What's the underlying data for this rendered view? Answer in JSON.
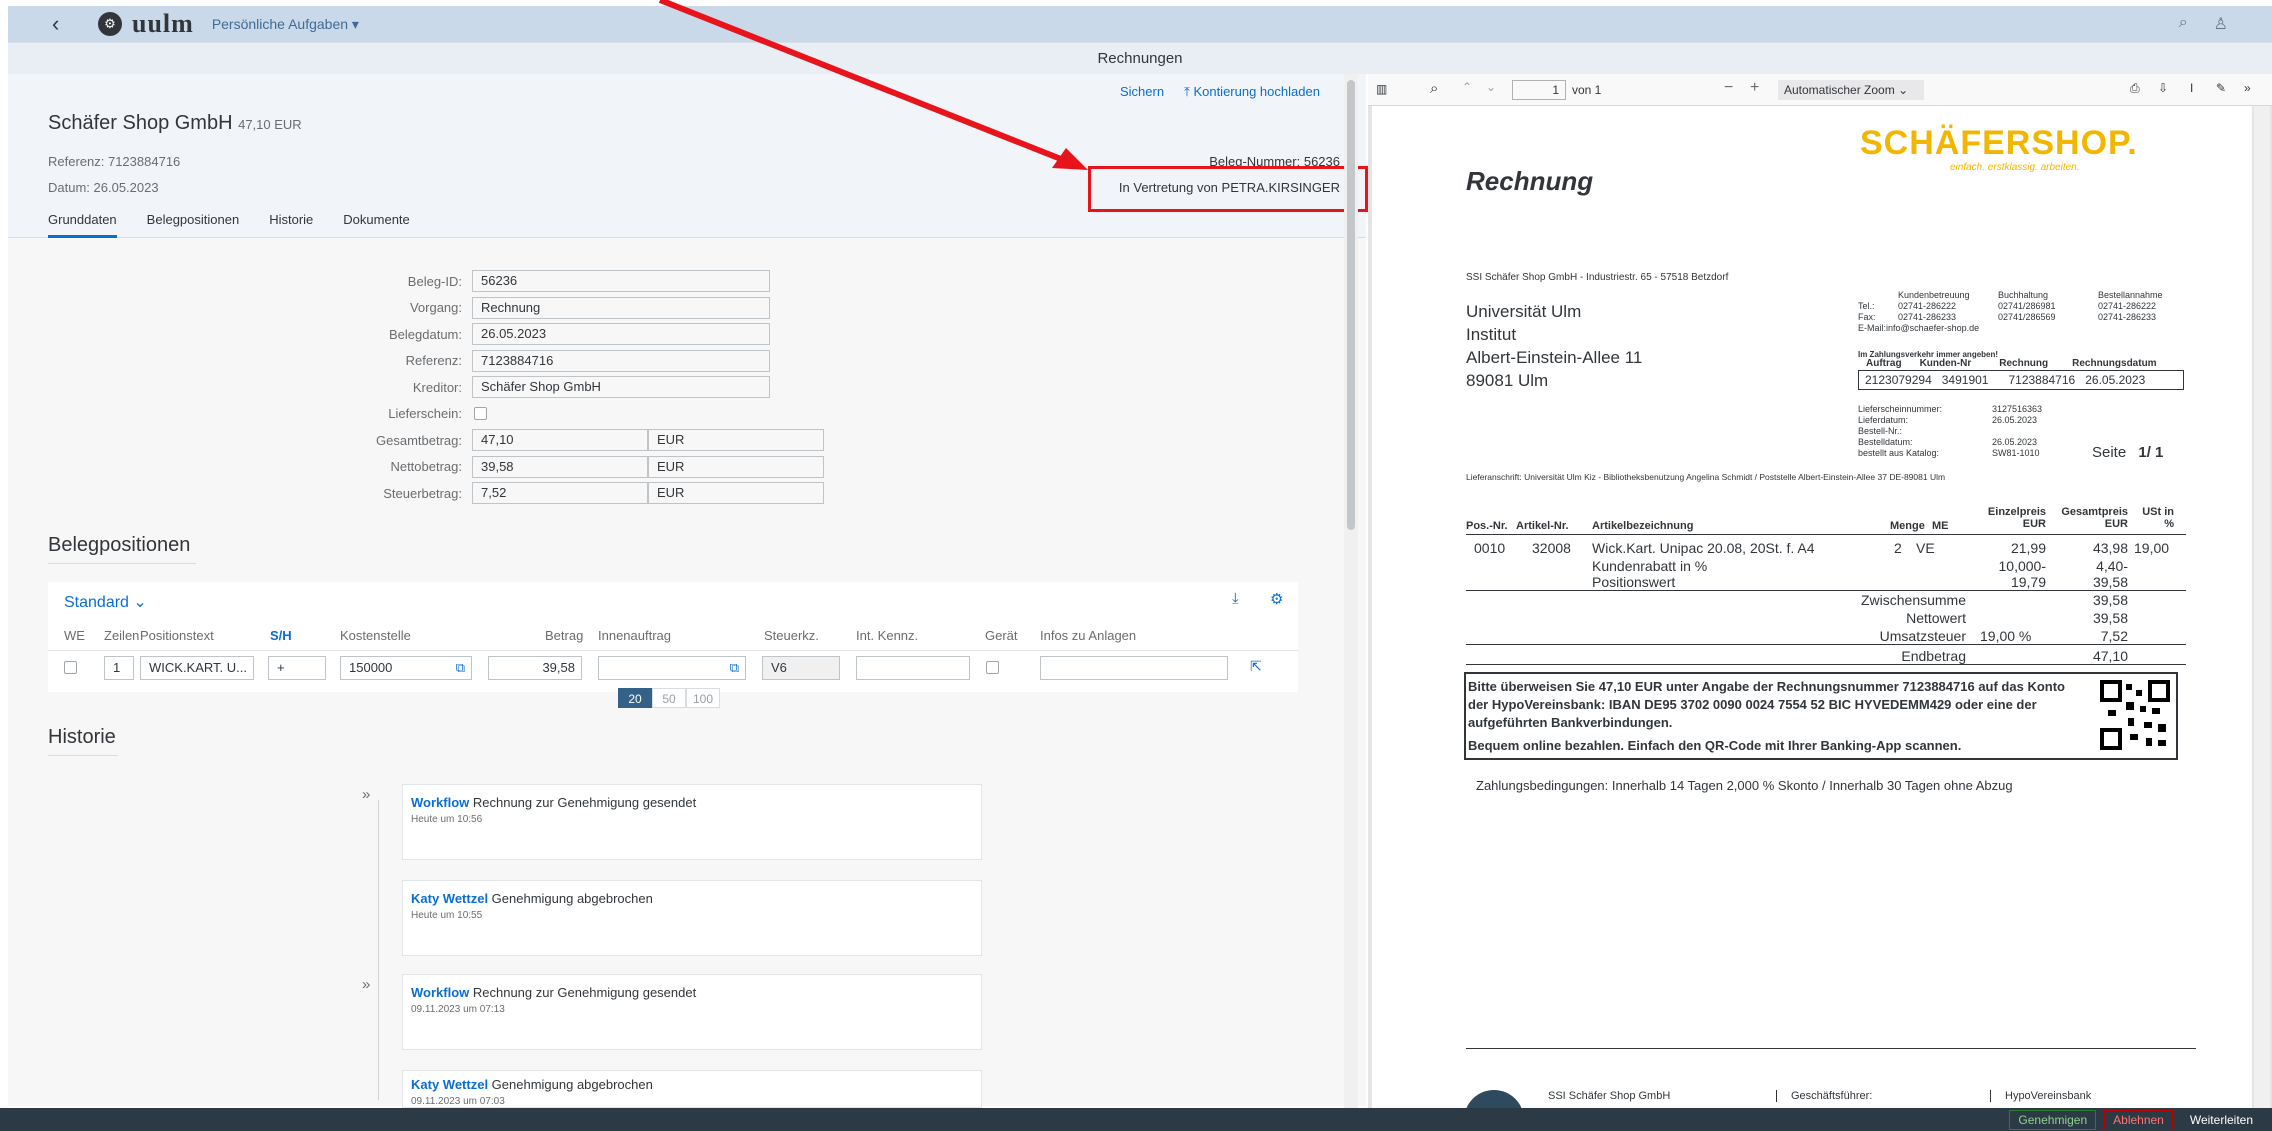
{
  "shell": {
    "app_title": "Persönliche Aufgaben ▾",
    "logo_text": "uulm",
    "logo_symbol": "⚙"
  },
  "page_header": "Rechnungen",
  "header": {
    "vendor": "Schäfer Shop GmbH",
    "amount": "47,10 EUR",
    "referenz": "Referenz: 7123884716",
    "datum": "Datum: 26.05.2023",
    "beleg_nummer": "Beleg-Nummer: 56236",
    "vertretung": "In Vertretung von PETRA.KIRSINGER",
    "actions": {
      "save": "Sichern",
      "upload": "Kontierung hochladen"
    }
  },
  "tabs": [
    "Grunddaten",
    "Belegpositionen",
    "Historie",
    "Dokumente"
  ],
  "grunddaten": {
    "beleg_id": {
      "label": "Beleg-ID:",
      "value": "56236"
    },
    "vorgang": {
      "label": "Vorgang:",
      "value": "Rechnung"
    },
    "belegdatum": {
      "label": "Belegdatum:",
      "value": "26.05.2023"
    },
    "referenz": {
      "label": "Referenz:",
      "value": "7123884716"
    },
    "kreditor": {
      "label": "Kreditor:",
      "value": "Schäfer Shop GmbH"
    },
    "lieferschein": {
      "label": "Lieferschein:"
    },
    "gesamtbetrag": {
      "label": "Gesamtbetrag:",
      "value": "47,10",
      "currency": "EUR"
    },
    "nettobetrag": {
      "label": "Nettobetrag:",
      "value": "39,58",
      "currency": "EUR"
    },
    "steuerbetrag": {
      "label": "Steuerbetrag:",
      "value": "7,52",
      "currency": "EUR"
    }
  },
  "belegpositionen": {
    "title": "Belegpositionen",
    "variant": "Standard",
    "columns": [
      "WE",
      "Zeilen",
      "Positionstext",
      "S/H",
      "Kostenstelle",
      "Betrag",
      "Innenauftrag",
      "Steuerkz.",
      "Int. Kennz.",
      "Gerät",
      "Infos zu Anlagen"
    ],
    "row": {
      "zeile": "1",
      "text": "WICK.KART. U...",
      "sh": "+",
      "kostenstelle": "150000",
      "betrag": "39,58",
      "steuerkz": "V6"
    },
    "pager": [
      "20",
      "50",
      "100"
    ]
  },
  "historie": {
    "title": "Historie",
    "entries": [
      {
        "who": "Workflow",
        "text": " Rechnung zur Genehmigung gesendet",
        "time": "Heute um 10:56"
      },
      {
        "who": "Katy Wettzel",
        "text": " Genehmigung abgebrochen",
        "time": "Heute um 10:55"
      },
      {
        "who": "Workflow",
        "text": " Rechnung zur Genehmigung gesendet",
        "time": "09.11.2023 um 07:13"
      },
      {
        "who": "Katy Wettzel",
        "text": " Genehmigung abgebrochen",
        "time": "09.11.2023 um 07:03"
      }
    ]
  },
  "pdf_toolbar": {
    "page": "1",
    "of": "von 1",
    "zoom": "Automatischer Zoom"
  },
  "invoice": {
    "brand": "SCHÄFERSHOP.",
    "brand_tag": "einfach. erstklassig. arbeiten.",
    "title": "Rechnung",
    "sender": "SSI Schäfer Shop GmbH  -  Industriestr. 65  -  57518 Betzdorf",
    "recipient": [
      "Universität Ulm",
      "Institut",
      "Albert-Einstein-Allee 11",
      "89081 Ulm"
    ],
    "contact_head": [
      "Kundenbetreuung",
      "Buchhaltung",
      "Bestellannahme"
    ],
    "tel": [
      "Tel.:",
      "02741-286222",
      "02741/286981",
      "02741-286222"
    ],
    "fax": [
      "Fax:",
      "02741-286233",
      "02741/286569",
      "02741-286233"
    ],
    "email": "E-Mail:info@schaefer-shop.de",
    "ref_note": "Im Zahlungsverkehr immer angeben!",
    "ref_head": [
      "Auftrag",
      "Kunden-Nr",
      "Rechnung",
      "Rechnungsdatum"
    ],
    "ref_vals": [
      "2123079294",
      "3491901",
      "7123884716",
      "26.05.2023"
    ],
    "meta_labels": [
      "Lieferscheinnummer:",
      "Lieferdatum:",
      "Bestell-Nr.:",
      "Bestelldatum:",
      "bestellt aus Katalog:"
    ],
    "meta_vals": [
      "3127516363",
      "26.05.2023",
      "",
      "26.05.2023",
      "SW81-1010"
    ],
    "seite": "Seite",
    "seite_val": "1/ 1",
    "lieferanschrift": "Lieferanschrift: Universität Ulm Kiz - Bibliotheksbenutzung Angelina Schmidt / Poststelle Albert-Einstein-Allee 37 DE-89081 Ulm",
    "cols": [
      "Pos.-Nr.",
      "Artikel-Nr.",
      "Artikelbezeichnung",
      "Menge",
      "ME",
      "Einzelpreis EUR",
      "Gesamtpreis EUR",
      "USt in %"
    ],
    "item": {
      "pos": "0010",
      "art": "32008",
      "desc": "Wick.Kart. Unipac 20.08, 20St. f. A4",
      "menge": "2",
      "me": "VE",
      "ep": "21,99",
      "gp": "43,98",
      "ust": "19,00"
    },
    "rabatt": {
      "label": "Kundenrabatt in %",
      "ep": "10,000-",
      "gp": "4,40-"
    },
    "positionswert": {
      "label": "Positionswert",
      "ep": "19,79",
      "gp": "39,58"
    },
    "zwischensumme": {
      "label": "Zwischensumme",
      "val": "39,58"
    },
    "nettowert": {
      "label": "Nettowert",
      "val": "39,58"
    },
    "umsatzsteuer": {
      "label": "Umsatzsteuer",
      "pct": "19,00 %",
      "val": "7,52"
    },
    "endbetrag": {
      "label": "Endbetrag",
      "val": "47,10"
    },
    "pay_text": "Bitte überweisen Sie 47,10 EUR unter Angabe der Rechnungsnummer 7123884716 auf das Konto der HypoVereinsbank: IBAN DE95 3702 0090 0024 7554 52 BIC HYVEDEMM429 oder eine der aufgeführten Bankverbindungen.",
    "pay_online": "Bequem online bezahlen. Einfach den QR-Code mit  Ihrer Banking-App scannen.",
    "conditions": "Zahlungsbedingungen: Innerhalb  14 Tagen 2,000  % Skonto / Innerhalb  30 Tagen ohne Abzug",
    "footer": [
      "SSI Schäfer Shop GmbH",
      "Geschäftsführer:",
      "HypoVereinsbank"
    ]
  },
  "footer_buttons": {
    "approve": "Genehmigen",
    "reject": "Ablehnen",
    "forward": "Weiterleiten"
  },
  "colors": {
    "annotation": "#e8141c",
    "brand": "#f2b600",
    "link": "#0a6ed1"
  }
}
